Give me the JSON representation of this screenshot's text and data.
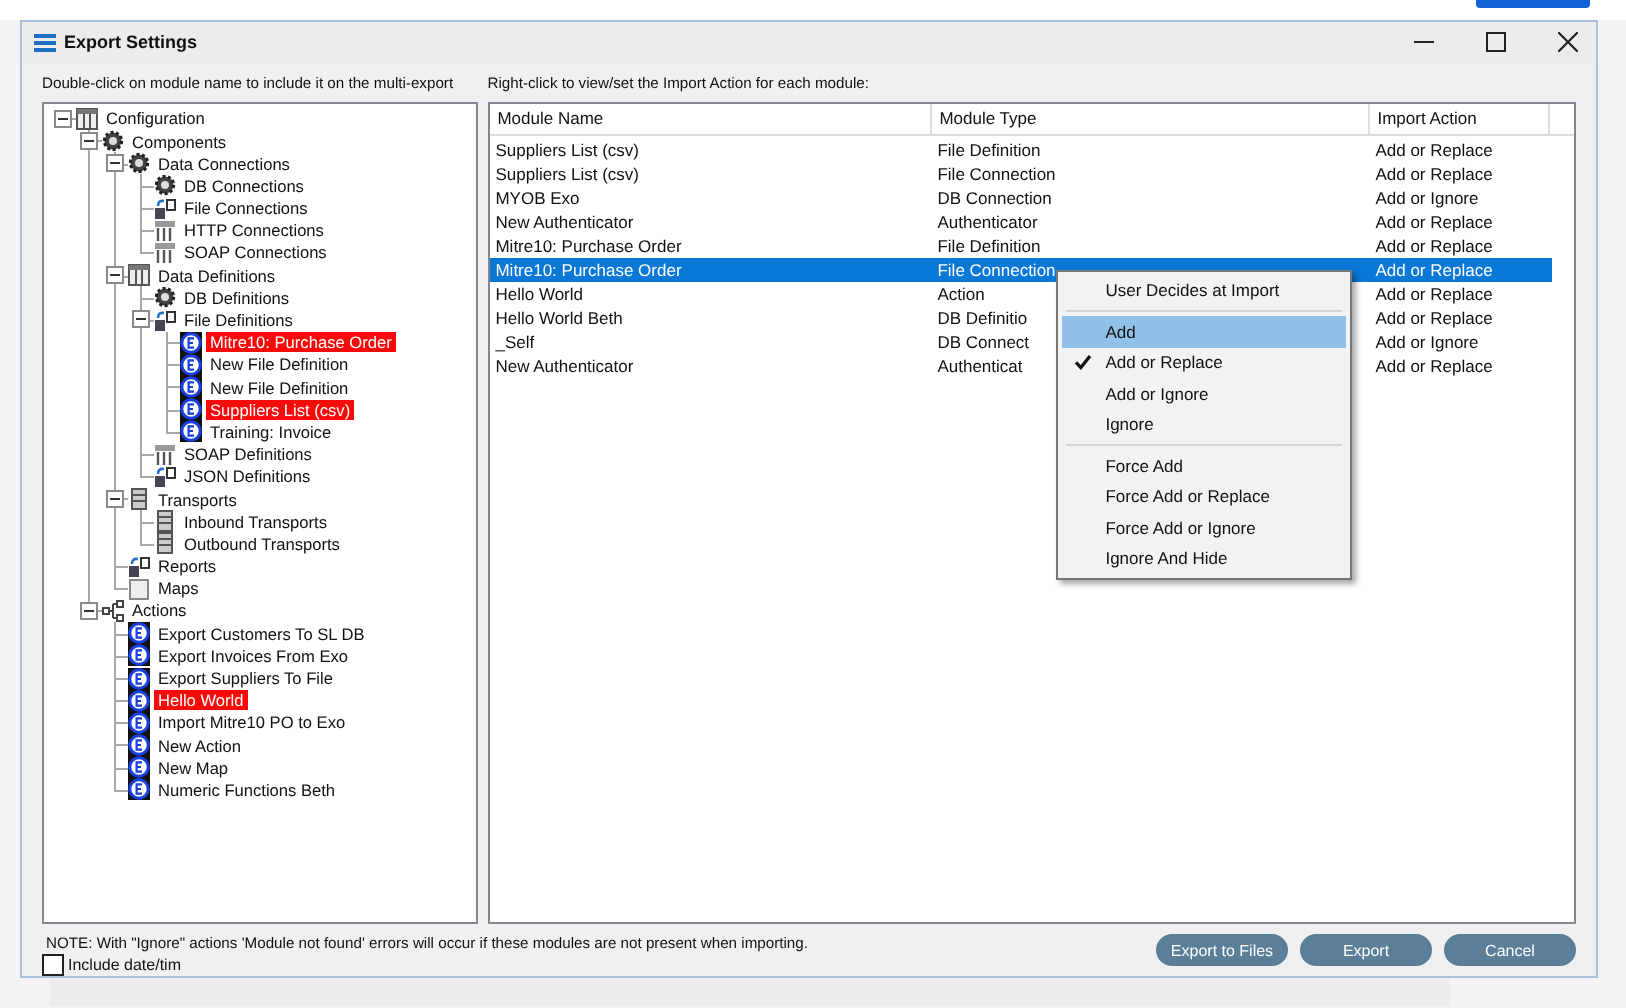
{
  "window": {
    "title": "Export Settings"
  },
  "left_panel": {
    "hint": "Double-click on module name to include it on the multi-export"
  },
  "tree": [
    {
      "label": "Configuration",
      "kind": "table",
      "expanded": true,
      "highlighted": false,
      "children": [
        {
          "label": "Components",
          "kind": "gear",
          "expanded": true,
          "highlighted": false,
          "children": [
            {
              "label": "Data Connections",
              "kind": "gear",
              "expanded": true,
              "highlighted": false,
              "children": [
                {
                  "label": "DB Connections",
                  "kind": "gear",
                  "highlighted": false
                },
                {
                  "label": "File Connections",
                  "kind": "transfer",
                  "highlighted": false
                },
                {
                  "label": "HTTP Connections",
                  "kind": "grid",
                  "highlighted": false
                },
                {
                  "label": "SOAP Connections",
                  "kind": "grid",
                  "highlighted": false
                }
              ]
            },
            {
              "label": "Data Definitions",
              "kind": "table",
              "expanded": true,
              "highlighted": false,
              "children": [
                {
                  "label": "DB Definitions",
                  "kind": "gear",
                  "highlighted": false
                },
                {
                  "label": "File Definitions",
                  "kind": "transfer",
                  "expanded": true,
                  "highlighted": false,
                  "children": [
                    {
                      "label": "Mitre10: Purchase Order",
                      "kind": "module",
                      "highlighted": true
                    },
                    {
                      "label": "New File Definition",
                      "kind": "module",
                      "highlighted": false
                    },
                    {
                      "label": "New File Definition",
                      "kind": "module",
                      "highlighted": false
                    },
                    {
                      "label": "Suppliers List (csv)",
                      "kind": "module",
                      "highlighted": true
                    },
                    {
                      "label": "Training: Invoice",
                      "kind": "module",
                      "highlighted": false
                    }
                  ]
                },
                {
                  "label": "SOAP Definitions",
                  "kind": "grid",
                  "highlighted": false
                },
                {
                  "label": "JSON Definitions",
                  "kind": "transfer",
                  "highlighted": false
                }
              ]
            },
            {
              "label": "Transports",
              "kind": "server",
              "expanded": true,
              "highlighted": false,
              "children": [
                {
                  "label": "Inbound Transports",
                  "kind": "server",
                  "highlighted": false
                },
                {
                  "label": "Outbound Transports",
                  "kind": "server",
                  "highlighted": false
                }
              ]
            },
            {
              "label": "Reports",
              "kind": "transfer",
              "highlighted": false
            },
            {
              "label": "Maps",
              "kind": "blank",
              "highlighted": false
            }
          ]
        },
        {
          "label": "Actions",
          "kind": "network",
          "expanded": true,
          "highlighted": false,
          "children": [
            {
              "label": "Export Customers To SL DB",
              "kind": "module",
              "highlighted": false
            },
            {
              "label": "Export Invoices From Exo",
              "kind": "module",
              "highlighted": false
            },
            {
              "label": "Export Suppliers To File",
              "kind": "module",
              "highlighted": false
            },
            {
              "label": "Hello World",
              "kind": "module",
              "highlighted": true
            },
            {
              "label": "Import Mitre10 PO to Exo",
              "kind": "module",
              "highlighted": false
            },
            {
              "label": "New Action",
              "kind": "module",
              "highlighted": false
            },
            {
              "label": "New Map",
              "kind": "module",
              "highlighted": false
            },
            {
              "label": "Numeric Functions Beth",
              "kind": "module",
              "highlighted": false
            }
          ]
        }
      ]
    }
  ],
  "right_panel": {
    "hint": "Right-click to view/set the Import Action for each module:"
  },
  "table": {
    "columns": [
      "Module Name",
      "Module Type",
      "Import Action"
    ],
    "rows": [
      {
        "cells": [
          "Suppliers List (csv)",
          "File Definition",
          "Add or Replace"
        ],
        "selected": false
      },
      {
        "cells": [
          "Suppliers List (csv)",
          "File Connection",
          "Add or Replace"
        ],
        "selected": false
      },
      {
        "cells": [
          "MYOB Exo",
          "DB Connection",
          "Add or Ignore"
        ],
        "selected": false
      },
      {
        "cells": [
          "New Authenticator",
          "Authenticator",
          "Add or Replace"
        ],
        "selected": false
      },
      {
        "cells": [
          "Mitre10: Purchase Order",
          "File Definition",
          "Add or Replace"
        ],
        "selected": false
      },
      {
        "cells": [
          "Mitre10: Purchase Order",
          "File Connection",
          "Add or Replace"
        ],
        "selected": true
      },
      {
        "cells": [
          "Hello World",
          "Action",
          "Add or Replace"
        ],
        "selected": false
      },
      {
        "cells": [
          "Hello World Beth",
          "DB Definitio",
          "Add or Replace"
        ],
        "selected": false
      },
      {
        "cells": [
          "_Self",
          "DB Connect",
          "Add or Ignore"
        ],
        "selected": false
      },
      {
        "cells": [
          "New Authenticator",
          "Authenticat",
          "Add or Replace"
        ],
        "selected": false
      }
    ]
  },
  "context_menu": {
    "items": [
      {
        "kind": "item",
        "label": "User Decides at Import",
        "checked": false,
        "highlighted": false
      },
      {
        "kind": "separator"
      },
      {
        "kind": "item",
        "label": "Add",
        "checked": false,
        "highlighted": true
      },
      {
        "kind": "item",
        "label": "Add or Replace",
        "checked": true,
        "highlighted": false
      },
      {
        "kind": "item",
        "label": "Add or Ignore",
        "checked": false,
        "highlighted": false
      },
      {
        "kind": "item",
        "label": "Ignore",
        "checked": false,
        "highlighted": false
      },
      {
        "kind": "separator"
      },
      {
        "kind": "item",
        "label": "Force Add",
        "checked": false,
        "highlighted": false
      },
      {
        "kind": "item",
        "label": "Force Add or Replace",
        "checked": false,
        "highlighted": false
      },
      {
        "kind": "item",
        "label": "Force Add or Ignore",
        "checked": false,
        "highlighted": false
      },
      {
        "kind": "item",
        "label": "Ignore And Hide",
        "checked": false,
        "highlighted": false
      }
    ]
  },
  "footer": {
    "note": "NOTE: With \"Ignore\" actions 'Module not found' errors will occur if these modules are not present when importing.",
    "include_date": {
      "label": "Include date/tim",
      "checked": false
    }
  },
  "buttons": [
    "Export to Files",
    "Export",
    "Cancel"
  ]
}
